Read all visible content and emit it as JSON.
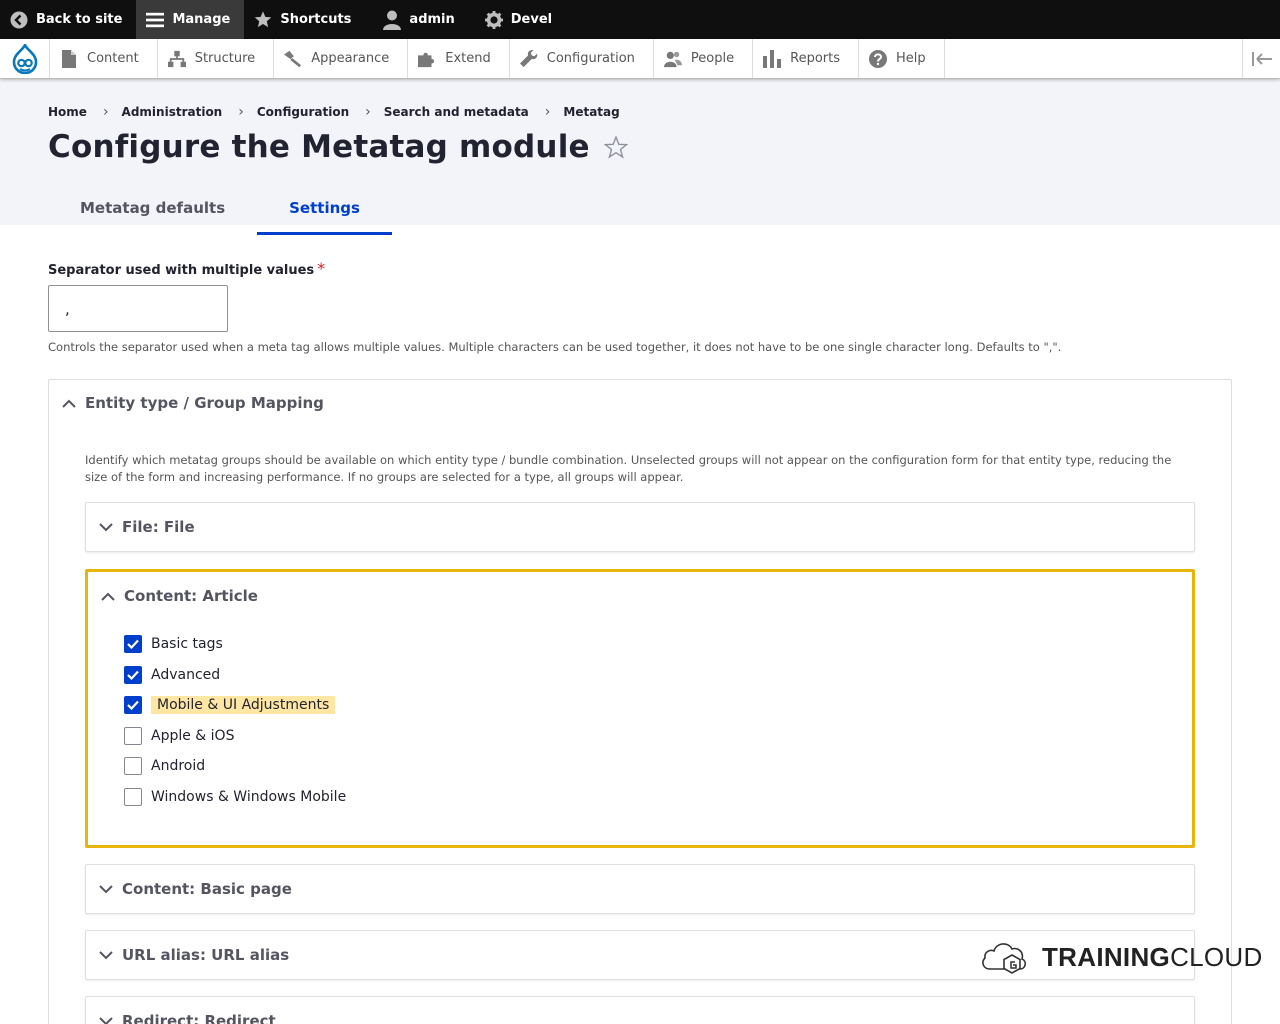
{
  "toolbar": {
    "back_to_site": "Back to site",
    "manage": "Manage",
    "shortcuts": "Shortcuts",
    "user": "admin",
    "devel": "Devel"
  },
  "tray": {
    "items": [
      "Content",
      "Structure",
      "Appearance",
      "Extend",
      "Configuration",
      "People",
      "Reports",
      "Help"
    ]
  },
  "breadcrumb": [
    "Home",
    "Administration",
    "Configuration",
    "Search and metadata",
    "Metatag"
  ],
  "page_title": "Configure the Metatag module",
  "tabs": [
    "Metatag defaults",
    "Settings"
  ],
  "active_tab": "Settings",
  "form": {
    "separator_label": "Separator used with multiple values",
    "required_mark": "*",
    "separator_value": ",",
    "separator_desc": "Controls the separator used when a meta tag allows multiple values. Multiple characters can be used together, it does not have to be one single character long. Defaults to \",\"."
  },
  "mapping": {
    "summary": "Entity type / Group Mapping",
    "description": "Identify which metatag groups should be available on which entity type / bundle combination. Unselected groups will not appear on the configuration form for that entity type, reducing the size of the form and increasing performance. If no groups are selected for a type, all groups will appear.",
    "sections": [
      "File: File",
      "Content: Article",
      "Content: Basic page",
      "URL alias: URL alias",
      "Redirect: Redirect"
    ],
    "article_groups": [
      {
        "label": "Basic tags",
        "checked": true
      },
      {
        "label": "Advanced",
        "checked": true
      },
      {
        "label": "Mobile & UI Adjustments",
        "checked": true
      },
      {
        "label": "Apple & iOS",
        "checked": false
      },
      {
        "label": "Android",
        "checked": false
      },
      {
        "label": "Windows & Windows Mobile",
        "checked": false
      }
    ]
  },
  "watermark": {
    "strong": "TRAINING",
    "light": "CLOUD"
  },
  "colors": {
    "accent": "#003ecc",
    "highlight_border": "#e7b50b",
    "toolbar": "#0f0f0f"
  }
}
